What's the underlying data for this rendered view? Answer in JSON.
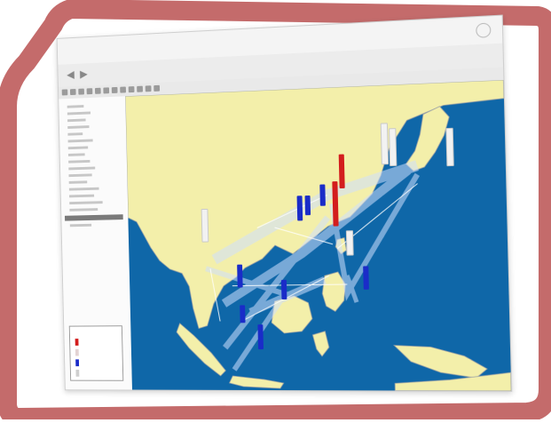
{
  "frame": {
    "color": "#c46b6b"
  },
  "window": {
    "accent_blue": "#0f67a8"
  },
  "icons": [
    "back-arrow-icon",
    "forward-arrow-icon",
    "reload-icon"
  ],
  "map": {
    "ocean_color": "#0f67a8",
    "land_color": "#f3efaa",
    "bars": {
      "red": "#d31d1d",
      "blue": "#1a2cc8",
      "white": "#f2f2f2"
    }
  },
  "legend": {
    "title": "",
    "items": [
      "",
      "",
      "",
      ""
    ]
  }
}
